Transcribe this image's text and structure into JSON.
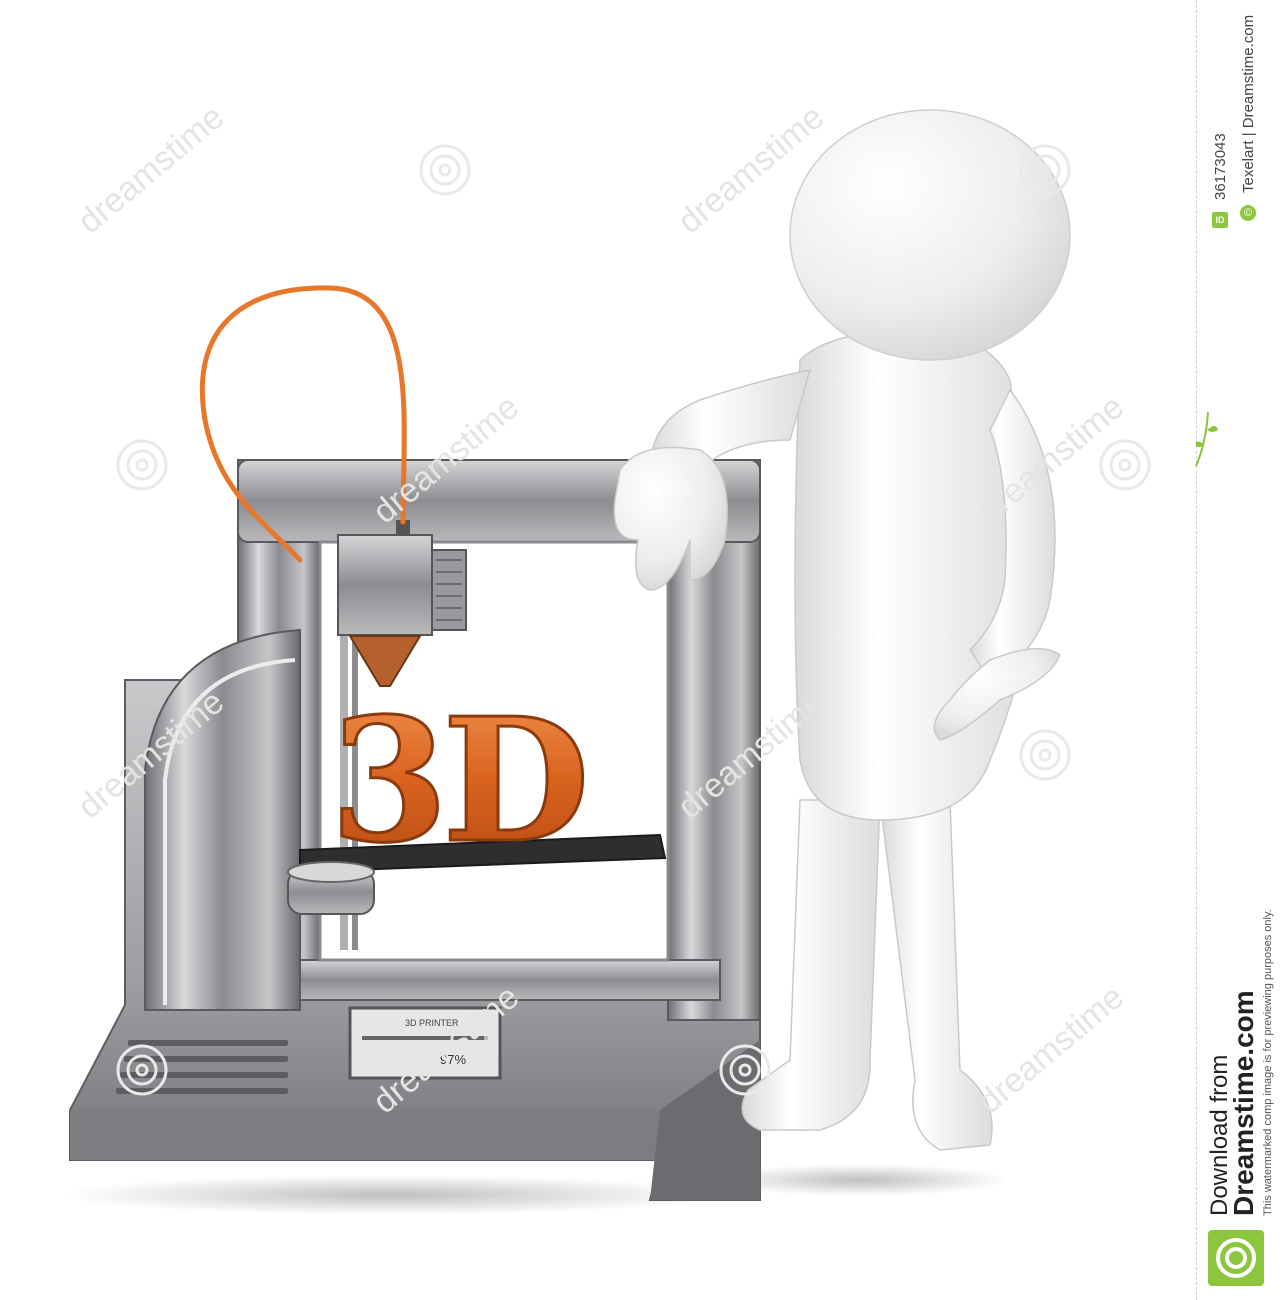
{
  "printed_letters": "3D",
  "printer_screen": {
    "line1": "3D PRINTER",
    "progress_text": "97%",
    "progress": 0.97
  },
  "watermark": {
    "text": "dreamstime",
    "id_label": "ID",
    "id_value": "36173043",
    "copyright_symbol": "©",
    "credit": "Texelart | Dreamstime.com",
    "download_from": "Download from",
    "site": "Dreamstime.com",
    "notice": "This watermarked comp image is for previewing purposes only."
  },
  "colors": {
    "background": "#ffffff",
    "filament": "#e8772a",
    "letters": "#d8621e",
    "metal": "#9a9a9e",
    "figure": "#f2f2f2",
    "brand_green": "#8cc63f"
  },
  "icons": [
    "spiral-watermark-icon",
    "twig-icon",
    "dreamstime-logo-icon"
  ]
}
